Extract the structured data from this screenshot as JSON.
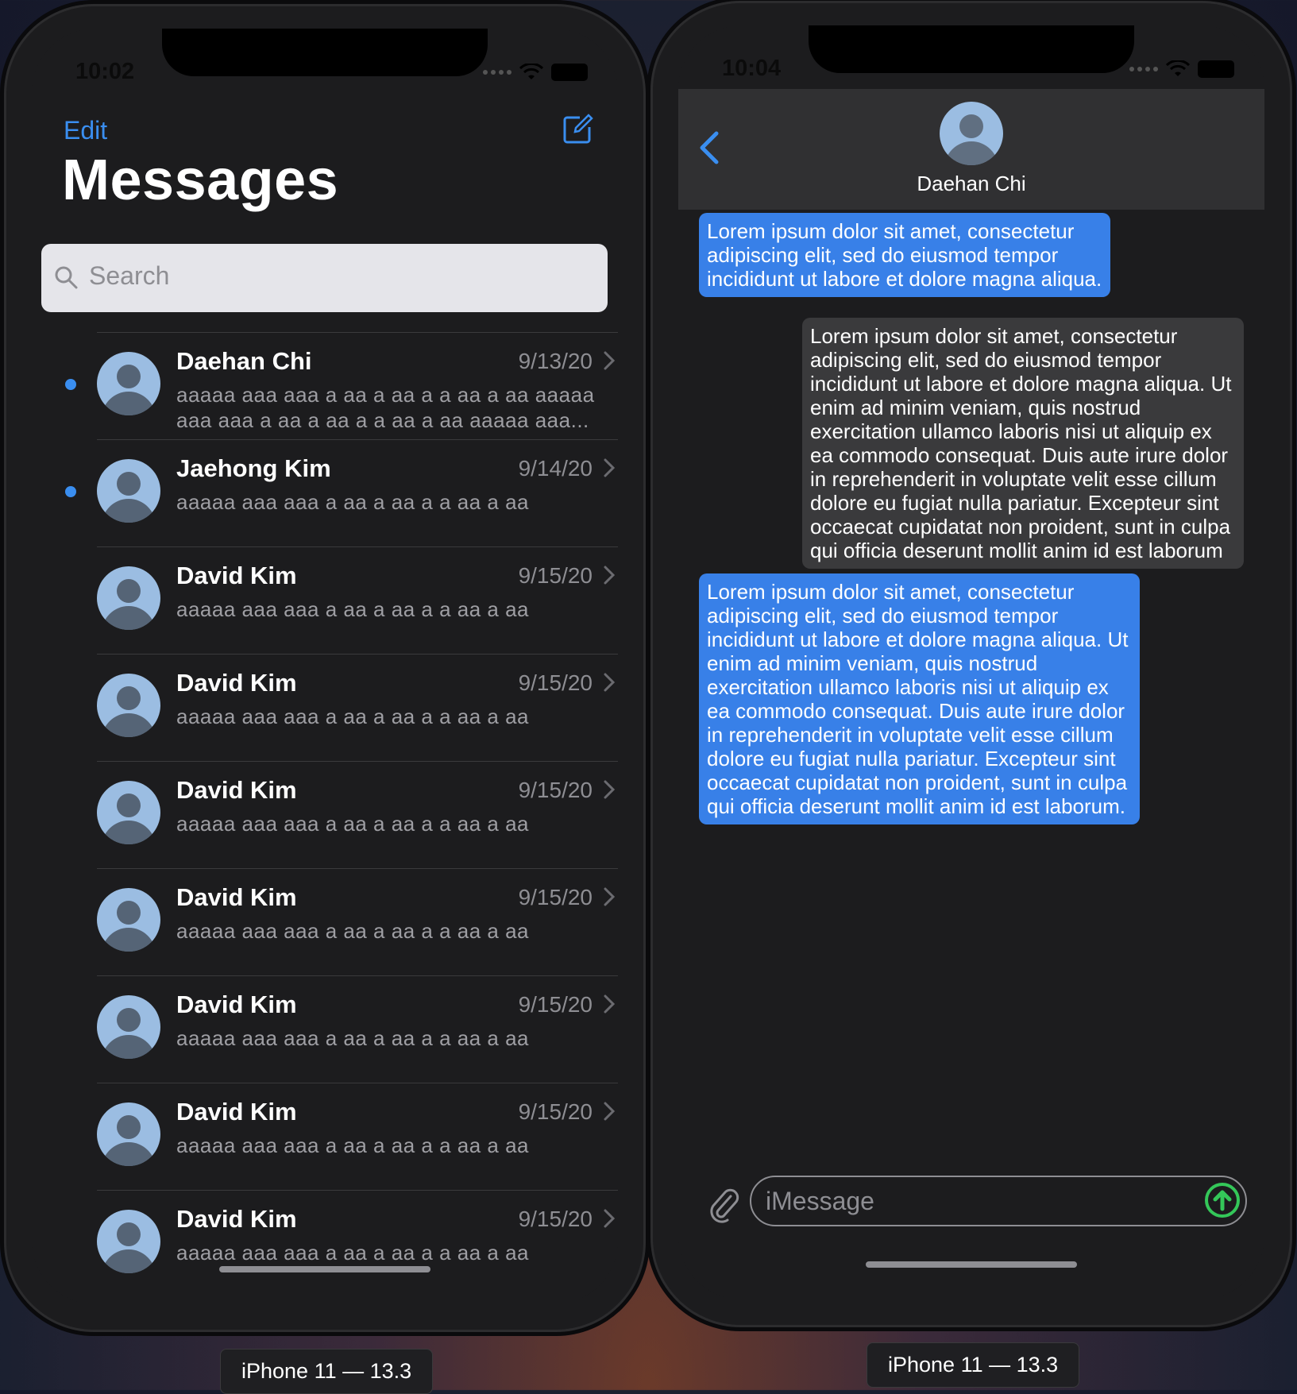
{
  "left": {
    "status_time": "10:02",
    "edit_label": "Edit",
    "title": "Messages",
    "search_placeholder": "Search",
    "conversations": [
      {
        "name": "Daehan Chi",
        "date": "9/13/20",
        "preview": "aaaaa aaa aaa a aa a  aa a a  aa  a aa aaaaa aaa aaa a aa a  aa a a  aa  a aa aaaaa aaa...",
        "unread": true
      },
      {
        "name": "Jaehong Kim",
        "date": "9/14/20",
        "preview": "aaaaa aaa aaa a aa a  aa a a  aa  a aa",
        "unread": true
      },
      {
        "name": "David Kim",
        "date": "9/15/20",
        "preview": "aaaaa aaa aaa a aa a  aa a a  aa  a aa",
        "unread": false
      },
      {
        "name": "David Kim",
        "date": "9/15/20",
        "preview": "aaaaa aaa aaa a aa a  aa a a  aa  a aa",
        "unread": false
      },
      {
        "name": "David Kim",
        "date": "9/15/20",
        "preview": "aaaaa aaa aaa a aa a  aa a a  aa  a aa",
        "unread": false
      },
      {
        "name": "David Kim",
        "date": "9/15/20",
        "preview": "aaaaa aaa aaa a aa a  aa a a  aa  a aa",
        "unread": false
      },
      {
        "name": "David Kim",
        "date": "9/15/20",
        "preview": "aaaaa aaa aaa a aa a  aa a a  aa  a aa",
        "unread": false
      },
      {
        "name": "David Kim",
        "date": "9/15/20",
        "preview": "aaaaa aaa aaa a aa a  aa a a  aa  a aa",
        "unread": false
      },
      {
        "name": "David Kim",
        "date": "9/15/20",
        "preview": "aaaaa aaa aaa a aa a  aa a a  aa  a aa",
        "unread": false
      }
    ],
    "device_label": "iPhone 11 — 13.3"
  },
  "right": {
    "status_time": "10:04",
    "contact_name": "Daehan Chi",
    "messages": [
      {
        "type": "sent",
        "text": "Lorem ipsum dolor sit amet, consectetur adipiscing elit, sed do eiusmod tempor incididunt ut labore et dolore magna aliqua."
      },
      {
        "type": "received",
        "text": "Lorem ipsum dolor sit amet, consectetur adipiscing elit, sed do eiusmod tempor incididunt ut labore et dolore magna aliqua. Ut enim ad minim veniam, quis nostrud exercitation ullamco laboris nisi ut aliquip ex ea commodo consequat. Duis aute irure dolor in reprehenderit in voluptate velit esse cillum dolore eu fugiat nulla pariatur. Excepteur sint occaecat cupidatat non proident, sunt in culpa qui officia deserunt mollit anim id est laborum"
      },
      {
        "type": "sent",
        "text": "Lorem ipsum dolor sit amet, consectetur adipiscing elit, sed do eiusmod tempor incididunt ut labore et dolore magna aliqua. Ut enim ad minim veniam, quis nostrud exercitation ullamco laboris nisi ut aliquip ex ea commodo consequat. Duis aute irure dolor in reprehenderit in voluptate velit esse cillum dolore eu fugiat nulla pariatur. Excepteur sint occaecat cupidatat non proident, sunt in culpa qui officia deserunt mollit anim id est laborum."
      }
    ],
    "input_placeholder": "iMessage",
    "device_label": "iPhone 11 — 13.3"
  },
  "colors": {
    "accent_blue": "#3a8ef0",
    "sent_bubble": "#3880e8",
    "received_bubble": "#3a3a3c",
    "send_green": "#34c759",
    "background": "#1c1c1e"
  }
}
